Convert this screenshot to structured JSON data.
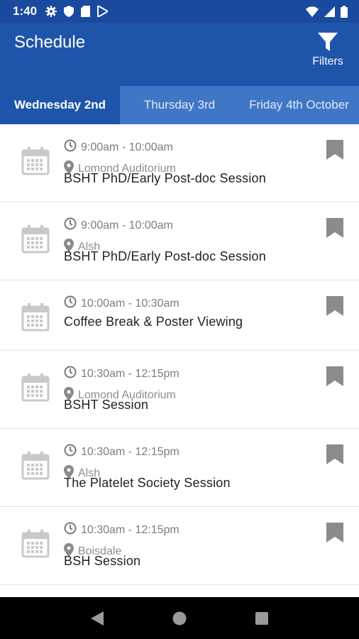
{
  "status_bar": {
    "time": "1:40",
    "icons_left": [
      "gear-icon",
      "shield-icon",
      "sd-card-icon",
      "play-store-icon"
    ],
    "icons_right": [
      "wifi-icon",
      "cell-signal-icon",
      "battery-icon"
    ]
  },
  "app_bar": {
    "title": "Schedule",
    "filters_label": "Filters",
    "colors": {
      "primary": "#1e55aa",
      "status": "#1a4aa0",
      "tab_strip": "#3f76c6"
    }
  },
  "tabs": [
    {
      "label": "Wednesday 2nd",
      "active": true
    },
    {
      "label": "Thursday 3rd",
      "active": false
    },
    {
      "label": "Friday 4th October",
      "active": false
    }
  ],
  "sessions": [
    {
      "time": "9:00am - 10:00am",
      "location": "Lomond Auditorium",
      "title": "BSHT PhD/Early Post-doc Session"
    },
    {
      "time": "9:00am - 10:00am",
      "location": "Alsh",
      "title": "BSHT PhD/Early Post-doc Session"
    },
    {
      "time": "10:00am - 10:30am",
      "location": "",
      "title": "Coffee Break & Poster Viewing"
    },
    {
      "time": "10:30am - 12:15pm",
      "location": "Lomond Auditorium",
      "title": "BSHT Session"
    },
    {
      "time": "10:30am - 12:15pm",
      "location": "Alsh",
      "title": "The Platelet Society Session"
    },
    {
      "time": "10:30am - 12:15pm",
      "location": "Boisdale",
      "title": "BSH Session"
    }
  ],
  "nav_bar": {
    "icons": [
      "back-icon",
      "home-icon",
      "recents-icon"
    ]
  }
}
